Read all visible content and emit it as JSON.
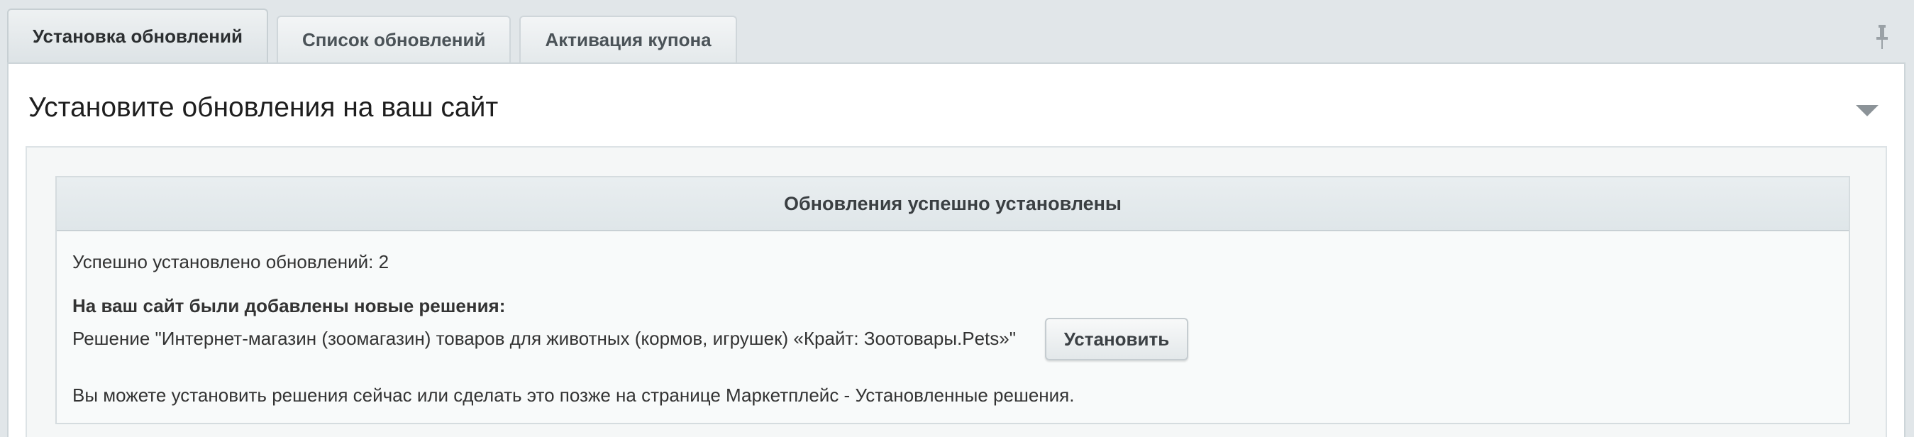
{
  "tabs": [
    {
      "label": "Установка обновлений",
      "active": true
    },
    {
      "label": "Список обновлений",
      "active": false
    },
    {
      "label": "Активация купона",
      "active": false
    }
  ],
  "panel": {
    "title": "Установите обновления на ваш сайт"
  },
  "result": {
    "header": "Обновления успешно установлены",
    "installed_count_text": "Успешно установлено обновлений: 2",
    "new_solutions_heading": "На ваш сайт были добавлены новые решения:",
    "solution_text": "Решение \"Интернет-магазин (зоомагазин) товаров для животных (кормов, игрушек) «Крайт: Зоотовары.Pets»\"",
    "install_button": "Установить",
    "note": "Вы можете установить решения сейчас или сделать это позже на странице Маркетплейс - Установленные решения."
  },
  "icons": {
    "pin": "pin-icon",
    "collapse": "chevron-down-icon"
  },
  "colors": {
    "background": "#e1e6e9",
    "panel": "#ffffff",
    "header": "#dfe6e9"
  }
}
